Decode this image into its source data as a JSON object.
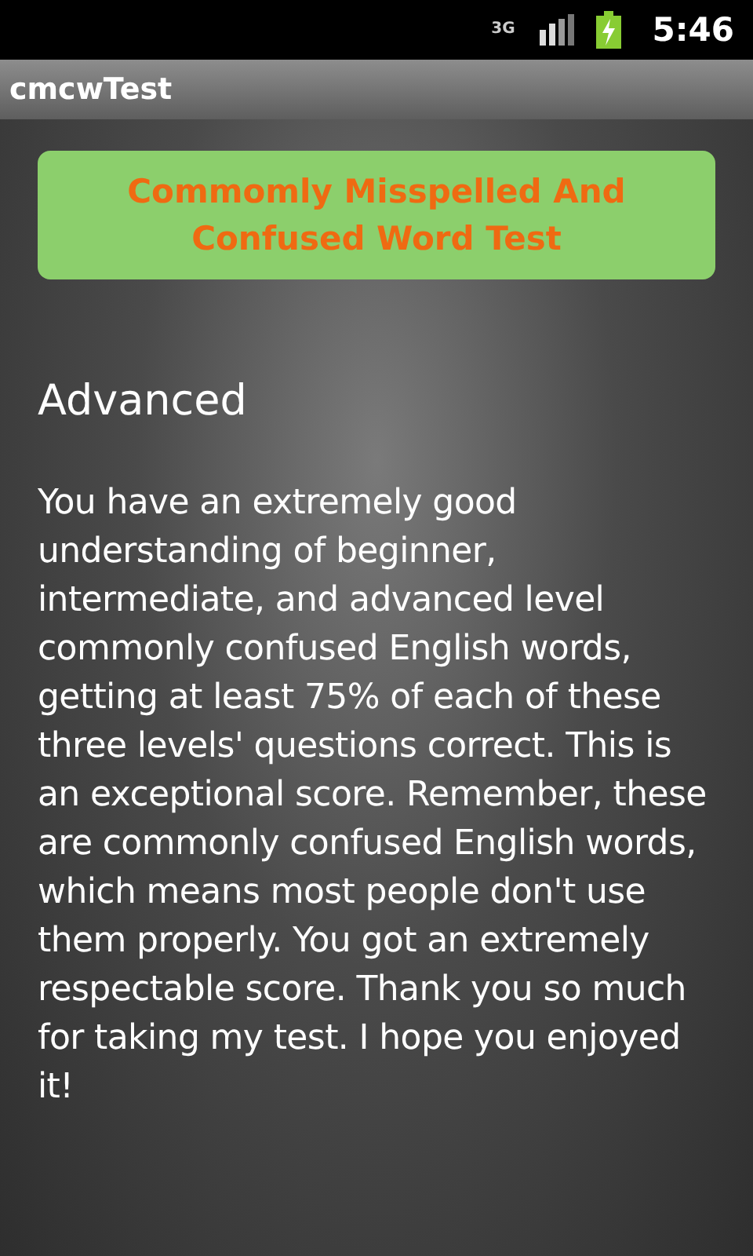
{
  "status_bar": {
    "network": "3G",
    "time": "5:46"
  },
  "title_bar": {
    "title": "cmcwTest"
  },
  "banner": {
    "label": "Commomly Misspelled And Confused Word Test"
  },
  "result": {
    "heading": "Advanced",
    "message": "You have an extremely good understanding of beginner, intermediate, and advanced level commonly confused English words, getting at least 75% of each of these three levels' questions correct. This is an exceptional score. Remember, these are commonly confused English words, which means most people don't use them properly. You got an extremely respectable score. Thank you so much for taking my test. I hope you enjoyed it!"
  }
}
